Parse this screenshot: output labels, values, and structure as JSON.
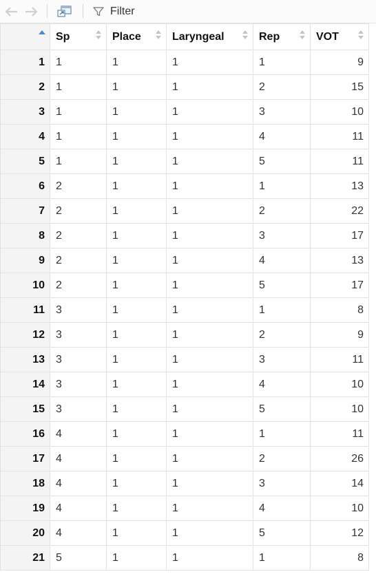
{
  "toolbar": {
    "back_icon": "arrow-left-icon",
    "forward_icon": "arrow-right-icon",
    "popout_icon": "show-in-new-window-icon",
    "filter_icon": "funnel-icon",
    "filter_label": "Filter"
  },
  "table": {
    "columns": [
      "",
      "Sp",
      "Place",
      "Laryngeal",
      "Rep",
      "VOT"
    ],
    "sorted_column": "row-index",
    "sort_direction": "ascending",
    "rows": [
      [
        "1",
        "1",
        "1",
        "1",
        "1",
        "9"
      ],
      [
        "2",
        "1",
        "1",
        "1",
        "2",
        "15"
      ],
      [
        "3",
        "1",
        "1",
        "1",
        "3",
        "10"
      ],
      [
        "4",
        "1",
        "1",
        "1",
        "4",
        "11"
      ],
      [
        "5",
        "1",
        "1",
        "1",
        "5",
        "11"
      ],
      [
        "6",
        "2",
        "1",
        "1",
        "1",
        "13"
      ],
      [
        "7",
        "2",
        "1",
        "1",
        "2",
        "22"
      ],
      [
        "8",
        "2",
        "1",
        "1",
        "3",
        "17"
      ],
      [
        "9",
        "2",
        "1",
        "1",
        "4",
        "13"
      ],
      [
        "10",
        "2",
        "1",
        "1",
        "5",
        "17"
      ],
      [
        "11",
        "3",
        "1",
        "1",
        "1",
        "8"
      ],
      [
        "12",
        "3",
        "1",
        "1",
        "2",
        "9"
      ],
      [
        "13",
        "3",
        "1",
        "1",
        "3",
        "11"
      ],
      [
        "14",
        "3",
        "1",
        "1",
        "4",
        "10"
      ],
      [
        "15",
        "3",
        "1",
        "1",
        "5",
        "10"
      ],
      [
        "16",
        "4",
        "1",
        "1",
        "1",
        "11"
      ],
      [
        "17",
        "4",
        "1",
        "1",
        "2",
        "26"
      ],
      [
        "18",
        "4",
        "1",
        "1",
        "3",
        "14"
      ],
      [
        "19",
        "4",
        "1",
        "1",
        "4",
        "10"
      ],
      [
        "20",
        "4",
        "1",
        "1",
        "5",
        "12"
      ],
      [
        "21",
        "5",
        "1",
        "1",
        "1",
        "8"
      ]
    ]
  }
}
